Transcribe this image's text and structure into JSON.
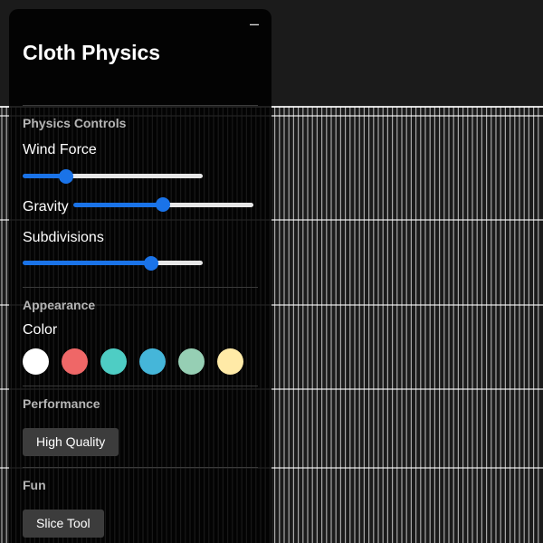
{
  "panel": {
    "title": "Cloth Physics",
    "minimize_glyph": "–"
  },
  "physics": {
    "section_title": "Physics Controls",
    "wind": {
      "label": "Wind Force",
      "value": 0.22
    },
    "gravity": {
      "label": "Gravity",
      "value": 0.5
    },
    "subdivisions": {
      "label": "Subdivisions",
      "value": 0.73
    }
  },
  "appearance": {
    "section_title": "Appearance",
    "color_label": "Color",
    "swatches": [
      "#ffffff",
      "#ef6767",
      "#4ecdc4",
      "#45b6d9",
      "#96cfb4",
      "#ffeaa7"
    ]
  },
  "performance": {
    "section_title": "Performance",
    "button_label": "High Quality"
  },
  "fun": {
    "section_title": "Fun",
    "button_label": "Slice Tool"
  },
  "colors": {
    "accent": "#1a73e8",
    "cloth": "#ffffff"
  }
}
